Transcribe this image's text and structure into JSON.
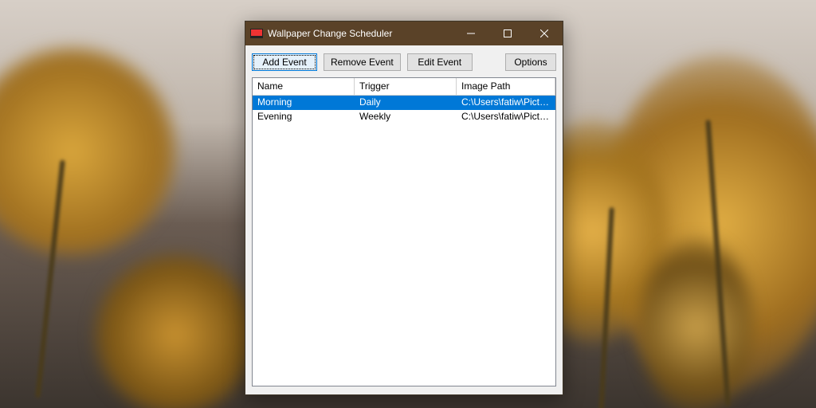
{
  "window": {
    "title": "Wallpaper Change Scheduler"
  },
  "toolbar": {
    "add_event": "Add Event",
    "remove_event": "Remove Event",
    "edit_event": "Edit Event",
    "options": "Options"
  },
  "table": {
    "columns": {
      "name": "Name",
      "trigger": "Trigger",
      "image_path": "Image Path"
    },
    "rows": [
      {
        "name": "Morning",
        "trigger": "Daily",
        "image_path": "C:\\Users\\fatiw\\Pictures\\wall...",
        "selected": true
      },
      {
        "name": "Evening",
        "trigger": "Weekly",
        "image_path": "C:\\Users\\fatiw\\Pictures\\wall...",
        "selected": false
      }
    ]
  }
}
